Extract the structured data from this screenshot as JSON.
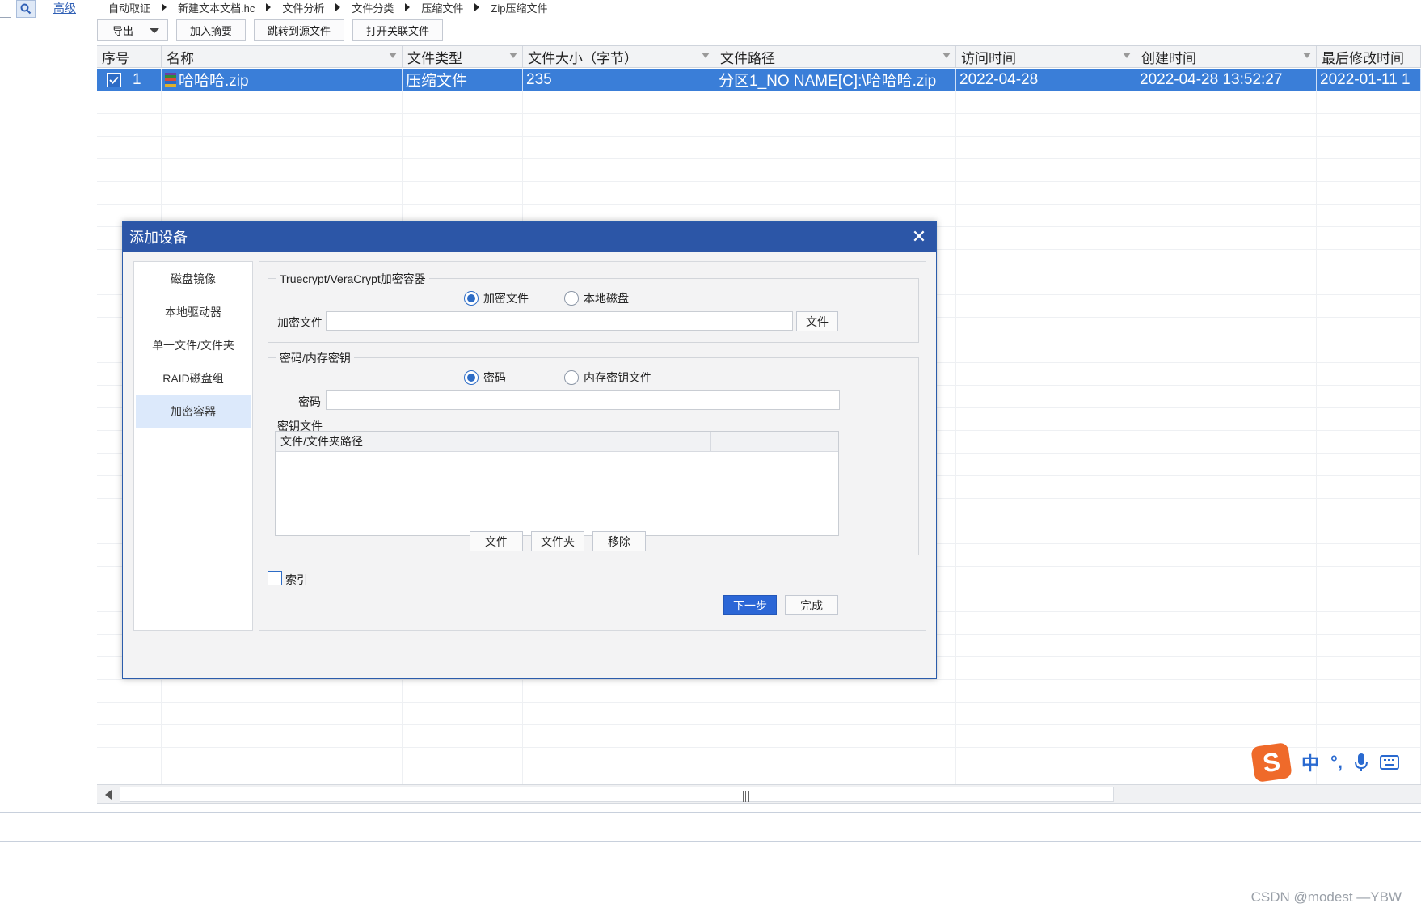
{
  "left": {
    "advanced_label": "高级"
  },
  "breadcrumb": [
    "自动取证",
    "新建文本文档.hc",
    "文件分析",
    "文件分类",
    "压缩文件",
    "Zip压缩文件"
  ],
  "toolbar": {
    "export_label": "导出",
    "add_summary_label": "加入摘要",
    "jump_source_label": "跳转到源文件",
    "open_related_label": "打开关联文件"
  },
  "table": {
    "columns": [
      "序号",
      "名称",
      "文件类型",
      "文件大小（字节）",
      "文件路径",
      "访问时间",
      "创建时间",
      "最后修改时间"
    ],
    "rows": [
      {
        "index": "1",
        "name": "哈哈哈.zip",
        "type": "压缩文件",
        "size": "235",
        "path": "分区1_NO NAME[C]:\\哈哈哈.zip",
        "accessed": "2022-04-28",
        "created": "2022-04-28 13:52:27",
        "modified": "2022-01-11 1"
      }
    ]
  },
  "dialog": {
    "title": "添加设备",
    "close_glyph": "✕",
    "nav": [
      "磁盘镜像",
      "本地驱动器",
      "单一文件/文件夹",
      "RAID磁盘组",
      "加密容器"
    ],
    "active_nav": 4,
    "container_group": {
      "label": "Truecrypt/VeraCrypt加密容器",
      "radio_file": "加密文件",
      "radio_disk": "本地磁盘",
      "selected": "加密文件",
      "file_label": "加密文件",
      "file_value": "",
      "file_button": "文件"
    },
    "password_group": {
      "label": "密码/内存密钥",
      "radio_password": "密码",
      "radio_keyfile": "内存密钥文件",
      "selected": "密码",
      "password_label": "密码",
      "password_value": "",
      "keyfile_label": "密钥文件",
      "table_header": "文件/文件夹路径",
      "btn_file": "文件",
      "btn_folder": "文件夹",
      "btn_remove": "移除"
    },
    "index_label": "索引",
    "index_checked": false,
    "next_label": "下一步",
    "finish_label": "完成"
  },
  "ime": {
    "items": [
      "中",
      "°,"
    ]
  },
  "watermark": "CSDN @modest —YBW",
  "colors": {
    "selection": "#3a7ed8",
    "dialog_title": "#2c56a7",
    "primary_button": "#2b66d6"
  }
}
